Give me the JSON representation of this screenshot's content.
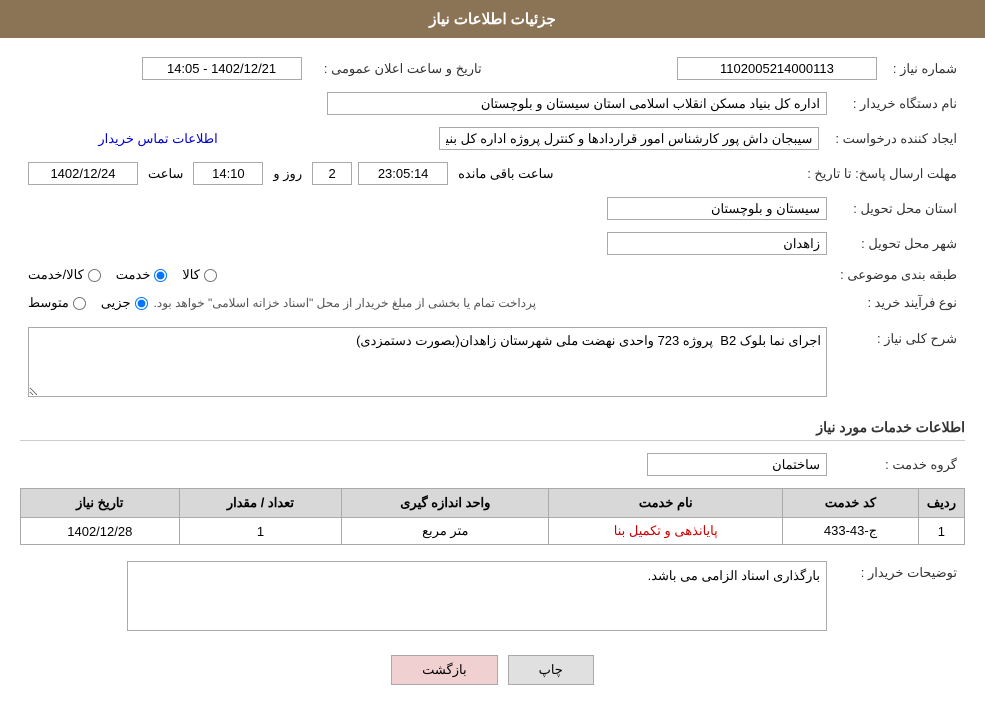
{
  "header": {
    "title": "جزئیات اطلاعات نیاز"
  },
  "form": {
    "shomareNiaz_label": "شماره نیاز :",
    "shomareNiaz_value": "1102005214000113",
    "namDastgah_label": "نام دستگاه خریدار :",
    "namDastgah_value": "اداره کل بنیاد مسکن انقلاب اسلامی استان سیستان و بلوچستان",
    "ijadKonande_label": "ایجاد کننده درخواست :",
    "ijadKonande_contact_link": "اطلاعات تماس خریدار",
    "ijadKonande_value": "سیبجان داش پور کارشناس امور قراردادها و کنترل پروژه اداره کل بنیاد مسکن انقلا",
    "mohlat_label": "مهلت ارسال پاسخ: تا تاریخ :",
    "mohlat_date": "1402/12/24",
    "mohlat_time_label": "ساعت",
    "mohlat_time_value": "14:10",
    "mohlat_days_label": "روز و",
    "mohlat_days_value": "2",
    "mohlat_remaining": "23:05:14",
    "mohlat_remaining_label": "ساعت باقی مانده",
    "ostan_label": "استان محل تحویل :",
    "ostan_value": "سیستان و بلوچستان",
    "shahr_label": "شهر محل تحویل :",
    "shahr_value": "زاهدان",
    "tabaqeBandi_label": "طبقه بندی موضوعی :",
    "tabaqeBandi_options": [
      {
        "label": "کالا",
        "value": "kala"
      },
      {
        "label": "خدمت",
        "value": "khedmat"
      },
      {
        "label": "کالا/خدمت",
        "value": "kala_khedmat"
      }
    ],
    "tabaqeBandi_selected": "khedmat",
    "noeFarayand_label": "نوع فرآیند خرید :",
    "noeFarayand_options": [
      {
        "label": "جزیی",
        "value": "jozi"
      },
      {
        "label": "متوسط",
        "value": "motavasset"
      }
    ],
    "noeFarayand_selected": "jozi",
    "noeFarayand_note": "پرداخت تمام یا بخشی از مبلغ خریدار از محل \"اسناد خزانه اسلامی\" خواهد بود.",
    "sharhKoli_label": "شرح کلی نیاز :",
    "sharhKoli_value": "اجرای نما بلوک B2  پروژه 723 واحدی نهضت ملی شهرستان زاهدان(بصورت دستمزدی)",
    "khadamat_section_title": "اطلاعات خدمات مورد نیاز",
    "groheKhedmat_label": "گروه خدمت :",
    "groheKhedmat_value": "ساختمان",
    "table_headers": {
      "radif": "ردیف",
      "kodKhedmat": "کد خدمت",
      "namKhedmat": "نام خدمت",
      "vahed": "واحد اندازه گیری",
      "tedad": "تعداد / مقدار",
      "tarikh": "تاریخ نیاز"
    },
    "table_rows": [
      {
        "radif": "1",
        "kodKhedmat": "ج-43-433",
        "namKhedmat": "پایانذهی و تکمیل بنا",
        "vahed": "متر مربع",
        "tedad": "1",
        "tarikh": "1402/12/28"
      }
    ],
    "toseifat_label": "توضیحات خریدار :",
    "toseifat_value": "بارگذاری اسناد الزامی می باشد.",
    "btn_print": "چاپ",
    "btn_back": "بازگشت",
    "tarikh_saate_elan": "تاریخ و ساعت اعلان عمومی :",
    "tarikh_saate_elan_value": "1402/12/21 - 14:05"
  }
}
